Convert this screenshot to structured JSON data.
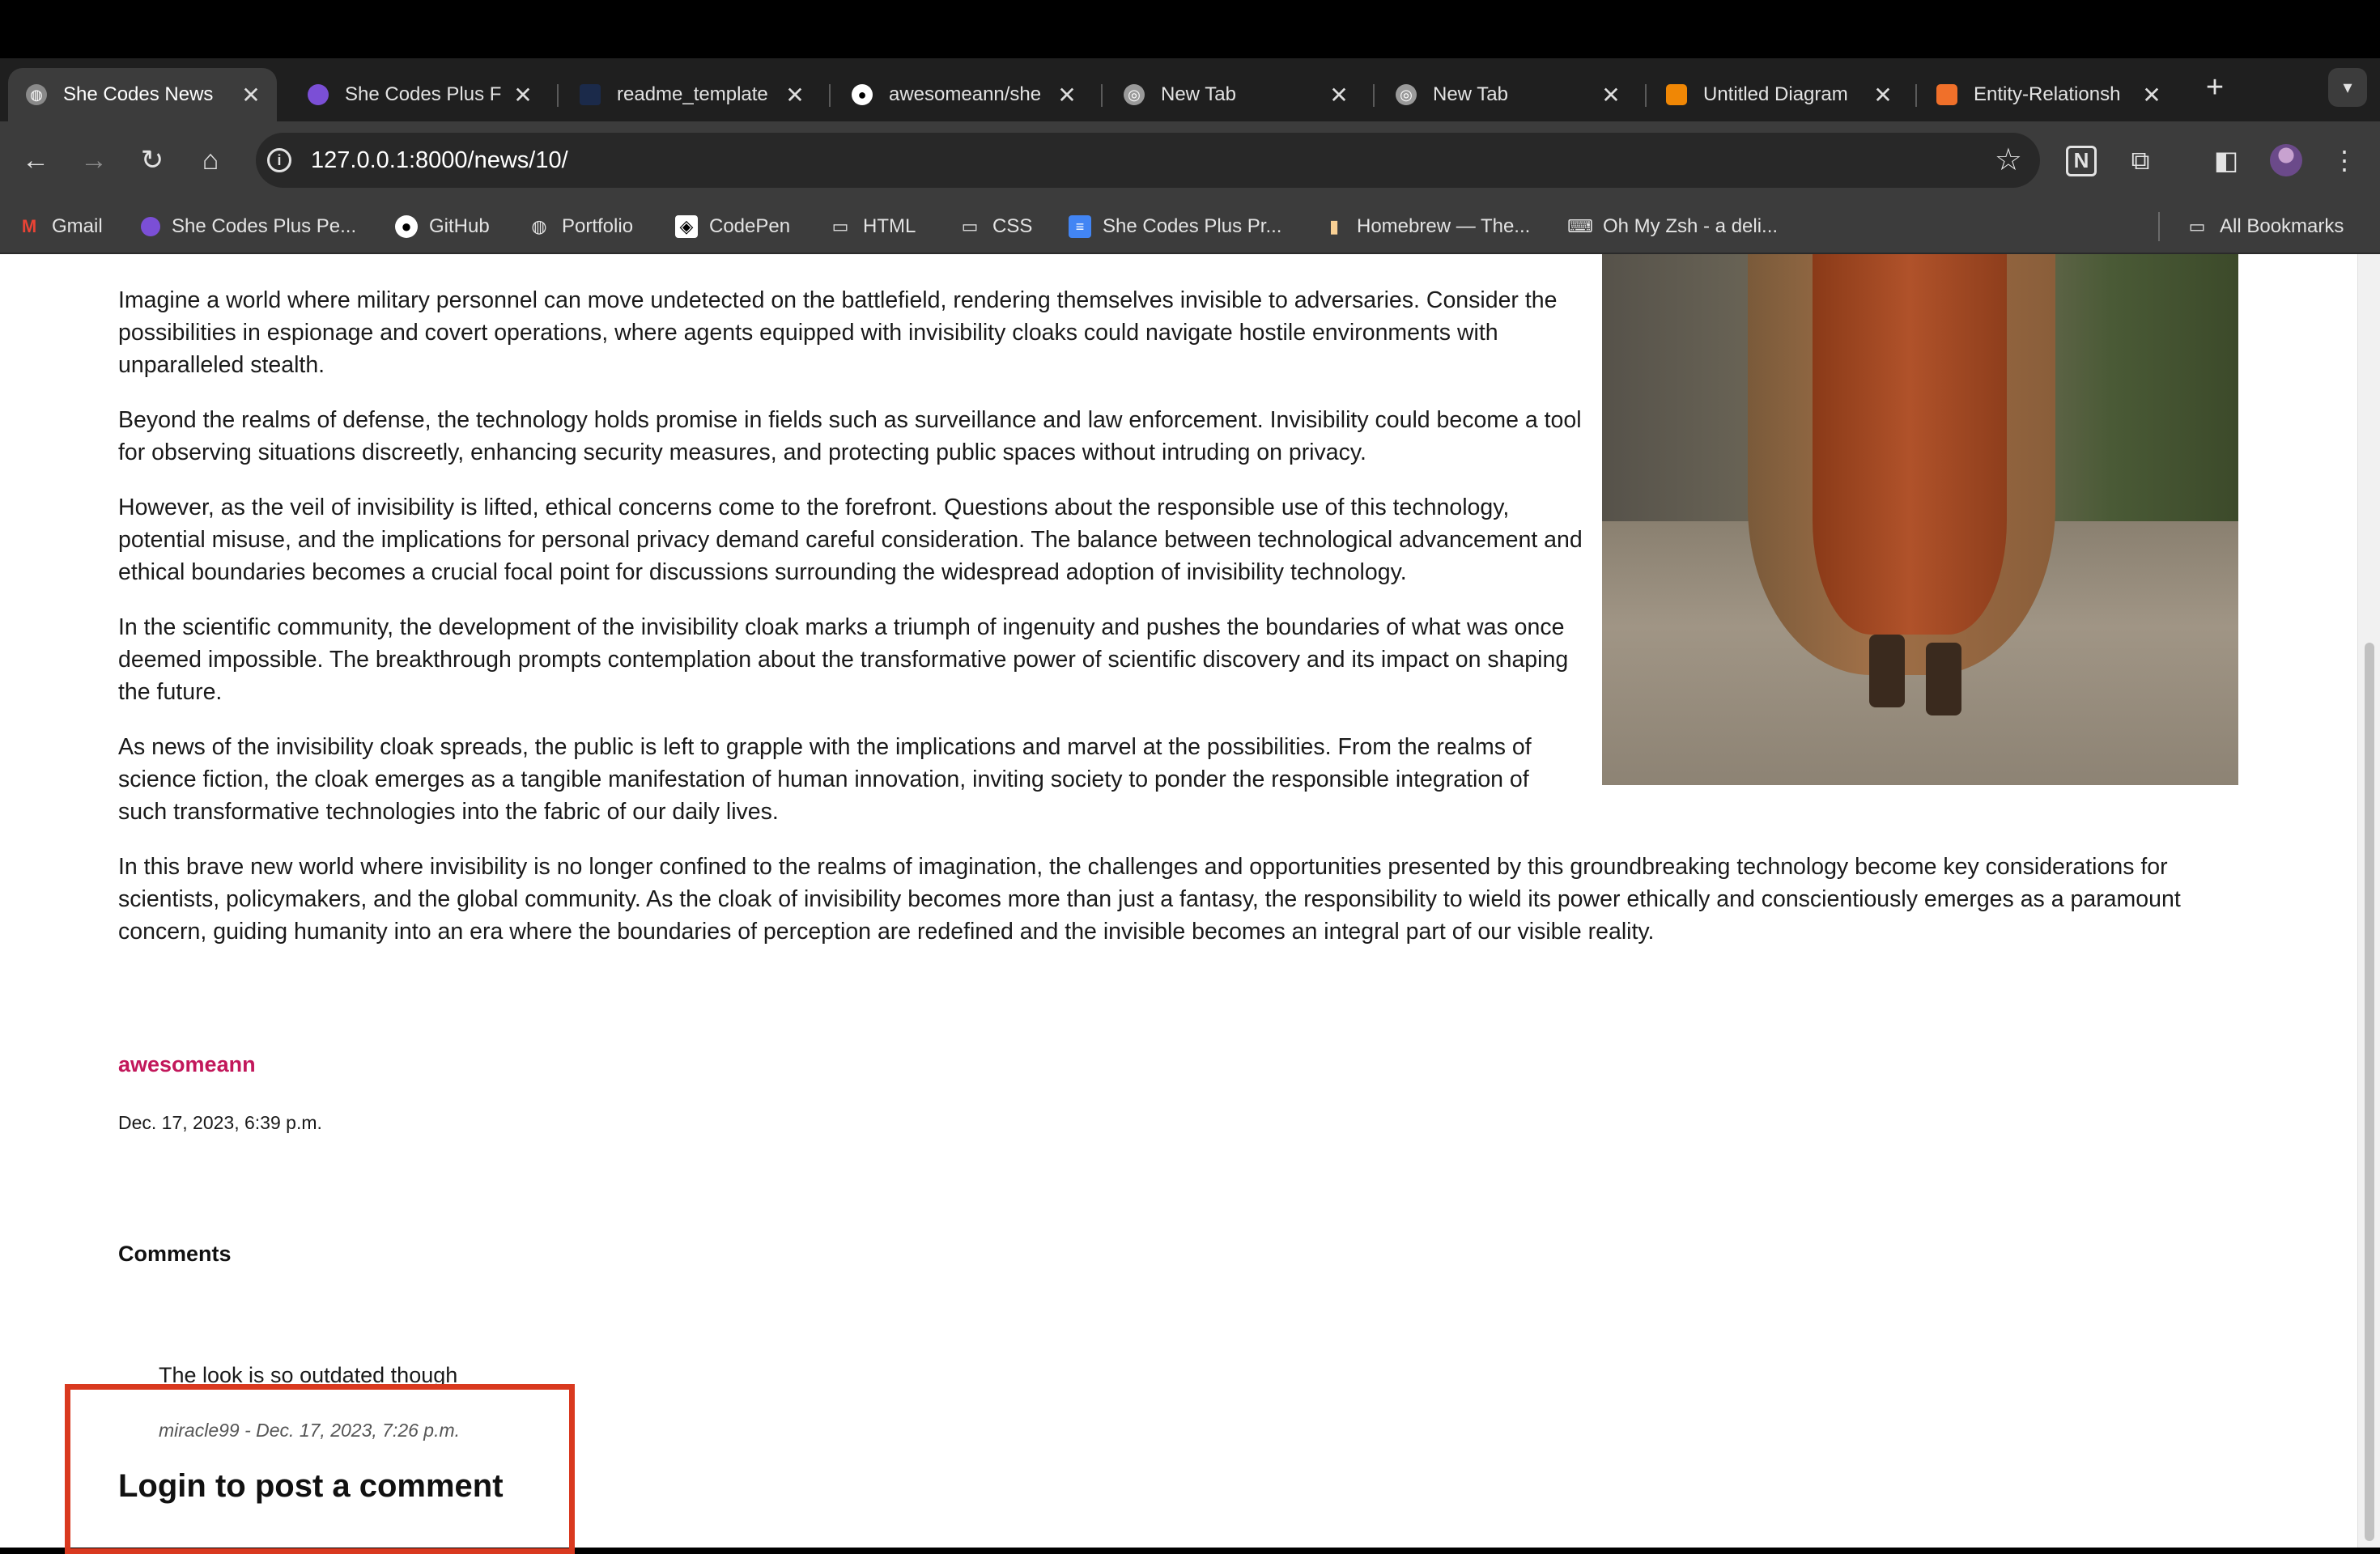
{
  "browser": {
    "tabs": [
      {
        "title": "She Codes News",
        "icon": "globe-icon",
        "active": true
      },
      {
        "title": "She Codes Plus F",
        "icon": "shecodes-icon",
        "active": false
      },
      {
        "title": "readme_template",
        "icon": "readme-icon",
        "active": false
      },
      {
        "title": "awesomeann/she",
        "icon": "github-icon",
        "active": false
      },
      {
        "title": "New Tab",
        "icon": "chrome-icon",
        "active": false
      },
      {
        "title": "New Tab",
        "icon": "chrome-icon",
        "active": false
      },
      {
        "title": "Untitled Diagram",
        "icon": "drawio-icon",
        "active": false
      },
      {
        "title": "Entity-Relationsh",
        "icon": "lucid-icon",
        "active": false
      }
    ],
    "close_glyph": "✕",
    "new_tab_glyph": "+",
    "url": "127.0.0.1:8000/news/10/",
    "bookmarks": [
      {
        "label": "Gmail",
        "icon": "gmail-icon"
      },
      {
        "label": "She Codes Plus Pe...",
        "icon": "shecodes-icon"
      },
      {
        "label": "GitHub",
        "icon": "github-icon"
      },
      {
        "label": "Portfolio",
        "icon": "globe-icon"
      },
      {
        "label": "CodePen",
        "icon": "codepen-icon"
      },
      {
        "label": "HTML",
        "icon": "folder-icon"
      },
      {
        "label": "CSS",
        "icon": "folder-icon"
      },
      {
        "label": "She Codes Plus Pr...",
        "icon": "docs-icon"
      },
      {
        "label": "Homebrew — The...",
        "icon": "homebrew-icon"
      },
      {
        "label": "Oh My Zsh - a deli...",
        "icon": "ohmyzsh-icon"
      }
    ],
    "all_bookmarks": "All Bookmarks"
  },
  "article": {
    "paragraphs": [
      "Imagine a world where military personnel can move undetected on the battlefield, rendering themselves invisible to adversaries. Consider the possibilities in espionage and covert operations, where agents equipped with invisibility cloaks could navigate hostile environments with unparalleled stealth.",
      "Beyond the realms of defense, the technology holds promise in fields such as surveillance and law enforcement. Invisibility could become a tool for observing situations discreetly, enhancing security measures, and protecting public spaces without intruding on privacy.",
      "However, as the veil of invisibility is lifted, ethical concerns come to the forefront. Questions about the responsible use of this technology, potential misuse, and the implications for personal privacy demand careful consideration. The balance between technological advancement and ethical boundaries becomes a crucial focal point for discussions surrounding the widespread adoption of invisibility technology.",
      "In the scientific community, the development of the invisibility cloak marks a triumph of ingenuity and pushes the boundaries of what was once deemed impossible. The breakthrough prompts contemplation about the transformative power of scientific discovery and its impact on shaping the future.",
      "As news of the invisibility cloak spreads, the public is left to grapple with the implications and marvel at the possibilities. From the realms of science fiction, the cloak emerges as a tangible manifestation of human innovation, inviting society to ponder the responsible integration of such transformative technologies into the fabric of our daily lives.",
      "In this brave new world where invisibility is no longer confined to the realms of imagination, the challenges and opportunities presented by this groundbreaking technology become key considerations for scientists, policymakers, and the global community. As the cloak of invisibility becomes more than just a fantasy, the responsibility to wield its power ethically and conscientiously emerges as a paramount concern, guiding humanity into an era where the boundaries of perception are redefined and the invisible becomes an integral part of our visible reality."
    ],
    "author": "awesomeann",
    "date": "Dec. 17, 2023, 6:39 p.m."
  },
  "comments": {
    "heading": "Comments",
    "items": [
      {
        "text": "The look is so outdated though",
        "meta": "miracle99 - Dec. 17, 2023, 7:26 p.m."
      }
    ],
    "login_prompt": "Login to post a comment"
  },
  "colors": {
    "author": "#c2185b",
    "highlight_box": "#d9391f"
  }
}
